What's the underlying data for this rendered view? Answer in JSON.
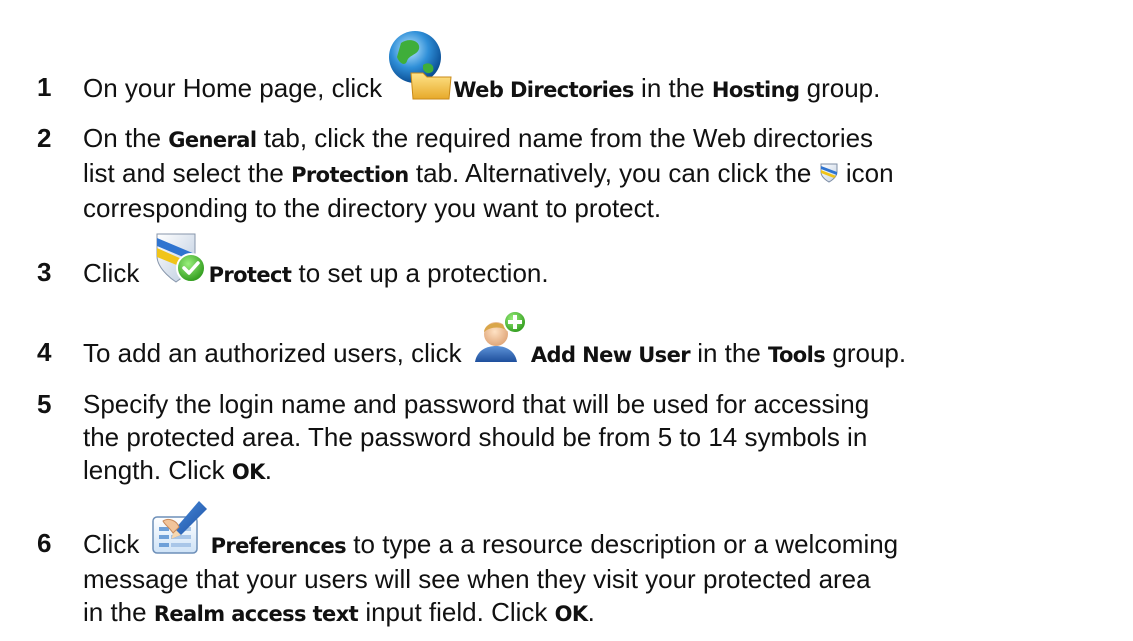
{
  "steps": [
    {
      "num": "1",
      "line1": {
        "a": "On your Home page, click ",
        "icon": "web-directories-icon",
        "b_label": "Web Directories",
        "c": " in the ",
        "d_bold": "Hosting",
        "e": " group."
      }
    },
    {
      "num": "2",
      "line1": {
        "a": "On the ",
        "b_bold": "General",
        "c": " tab, click the required name from the Web directories"
      },
      "line2": {
        "a": "list and select the ",
        "b_bold": "Protection",
        "c": " tab. Alternatively, you can click the ",
        "icon": "protection-shield-icon",
        "d": " icon"
      },
      "line3": "corresponding to the directory you want to protect."
    },
    {
      "num": "3",
      "line1": {
        "a": "Click ",
        "icon": "protect-shield-check-icon",
        "b_bold": "Protect",
        "c": " to set up a protection."
      }
    },
    {
      "num": "4",
      "line1": {
        "a": "To add an authorized users, click ",
        "icon": "add-new-user-icon",
        "b_bold": "Add New User",
        "c": " in the ",
        "d_bold": "Tools",
        "e": " group."
      }
    },
    {
      "num": "5",
      "line1": "Specify the login name and password that will be used for accessing",
      "line2": "the protected area. The password should be from 5 to 14 symbols in",
      "line3": {
        "a": "length. Click ",
        "b_bold": "OK",
        "c": "."
      }
    },
    {
      "num": "6",
      "line1": {
        "a": "Click ",
        "icon": "preferences-icon",
        "b_bold": "Preferences",
        "c": " to type a a resource description or a welcoming"
      },
      "line2": "message that your users will see when they visit your protected area",
      "line3": {
        "a": "in the ",
        "b_bold": "Realm access text",
        "c": " input field. Click ",
        "d_bold": "OK",
        "e": "."
      }
    }
  ]
}
